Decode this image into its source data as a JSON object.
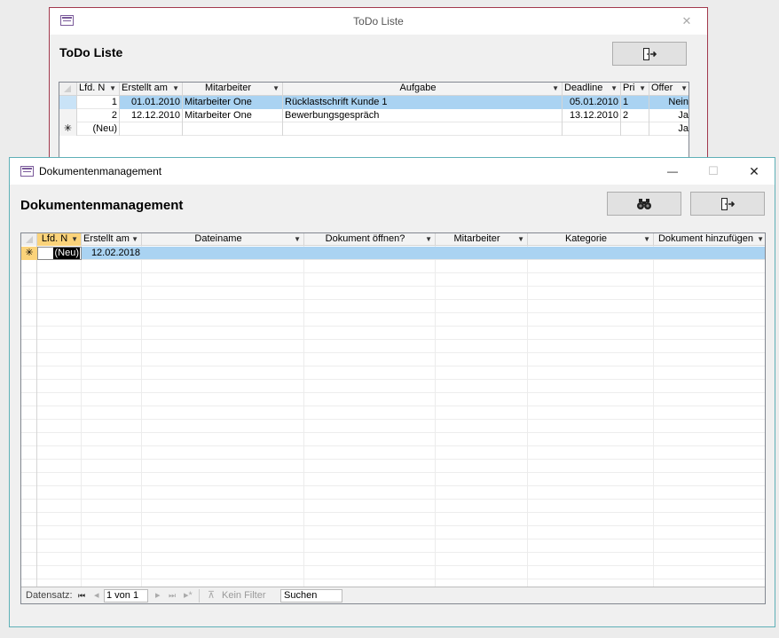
{
  "todo": {
    "window_title": "ToDo Liste",
    "form_title": "ToDo Liste",
    "close_glyph": "✕",
    "columns": [
      "Lfd. N",
      "Erstellt am",
      "Mitarbeiter",
      "Aufgabe",
      "Deadline",
      "Pri",
      "Offer"
    ],
    "rows": [
      {
        "lfd": "1",
        "erstellt": "01.01.2010",
        "mitarbeiter": "Mitarbeiter One",
        "aufgabe": "Rücklastschrift Kunde 1",
        "deadline": "05.01.2010",
        "pri": "1",
        "offen": "Nein"
      },
      {
        "lfd": "2",
        "erstellt": "12.12.2010",
        "mitarbeiter": "Mitarbeiter One",
        "aufgabe": "Bewerbungsgespräch",
        "deadline": "13.12.2010",
        "pri": "2",
        "offen": "Ja"
      }
    ],
    "new_row": {
      "lfd": "(Neu)",
      "offen": "Ja"
    }
  },
  "doc": {
    "window_title": "Dokumentenmanagement",
    "form_title": "Dokumentenmanagement",
    "min_glyph": "—",
    "max_glyph": "☐",
    "close_glyph": "✕",
    "columns": [
      "Lfd. N",
      "Erstellt am",
      "Dateiname",
      "Dokument öffnen?",
      "Mitarbeiter",
      "Kategorie",
      "Dokument hinzufügen"
    ],
    "new_row": {
      "lfd": "(Neu)",
      "erstellt": "12.02.2018"
    },
    "nav": {
      "label": "Datensatz:",
      "first": "⏮",
      "prev": "◂",
      "record": "1 von 1",
      "next": "▸",
      "last": "⏭",
      "new": "▸*",
      "filter": "Kein Filter",
      "search": "Suchen"
    }
  },
  "glyphs": {
    "dropdown": "▼",
    "new_marker": "✳"
  },
  "colors": {
    "selected_row": "#aad3f2",
    "active_header": "#fbd37a"
  }
}
